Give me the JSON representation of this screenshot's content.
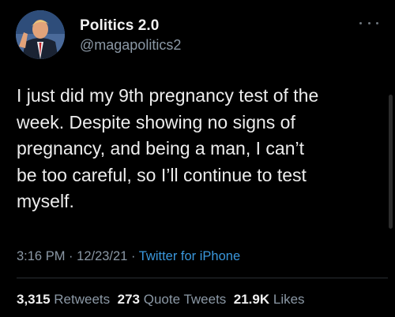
{
  "author": {
    "display_name": "Politics 2.0",
    "handle": "@magapolitics2",
    "avatar": "profile-photo"
  },
  "tweet": {
    "text": "I just did my 9th pregnancy test of the\nweek. Despite showing no signs of\npregnancy, and being a man, I can’t\nbe too careful, so I’ll continue to test\nmyself.",
    "time": "3:16 PM",
    "date": "12/23/21",
    "source": "Twitter for iPhone"
  },
  "stats": {
    "retweets_count": "3,315",
    "retweets_label": "Retweets",
    "quote_tweets_count": "273",
    "quote_tweets_label": "Quote Tweets",
    "likes_count": "21.9K",
    "likes_label": "Likes"
  },
  "icons": {
    "more": "more-options-icon"
  },
  "colors": {
    "background": "#000000",
    "text": "#e7e9ea",
    "secondary": "#8b98a5",
    "link": "#3a97dc"
  }
}
